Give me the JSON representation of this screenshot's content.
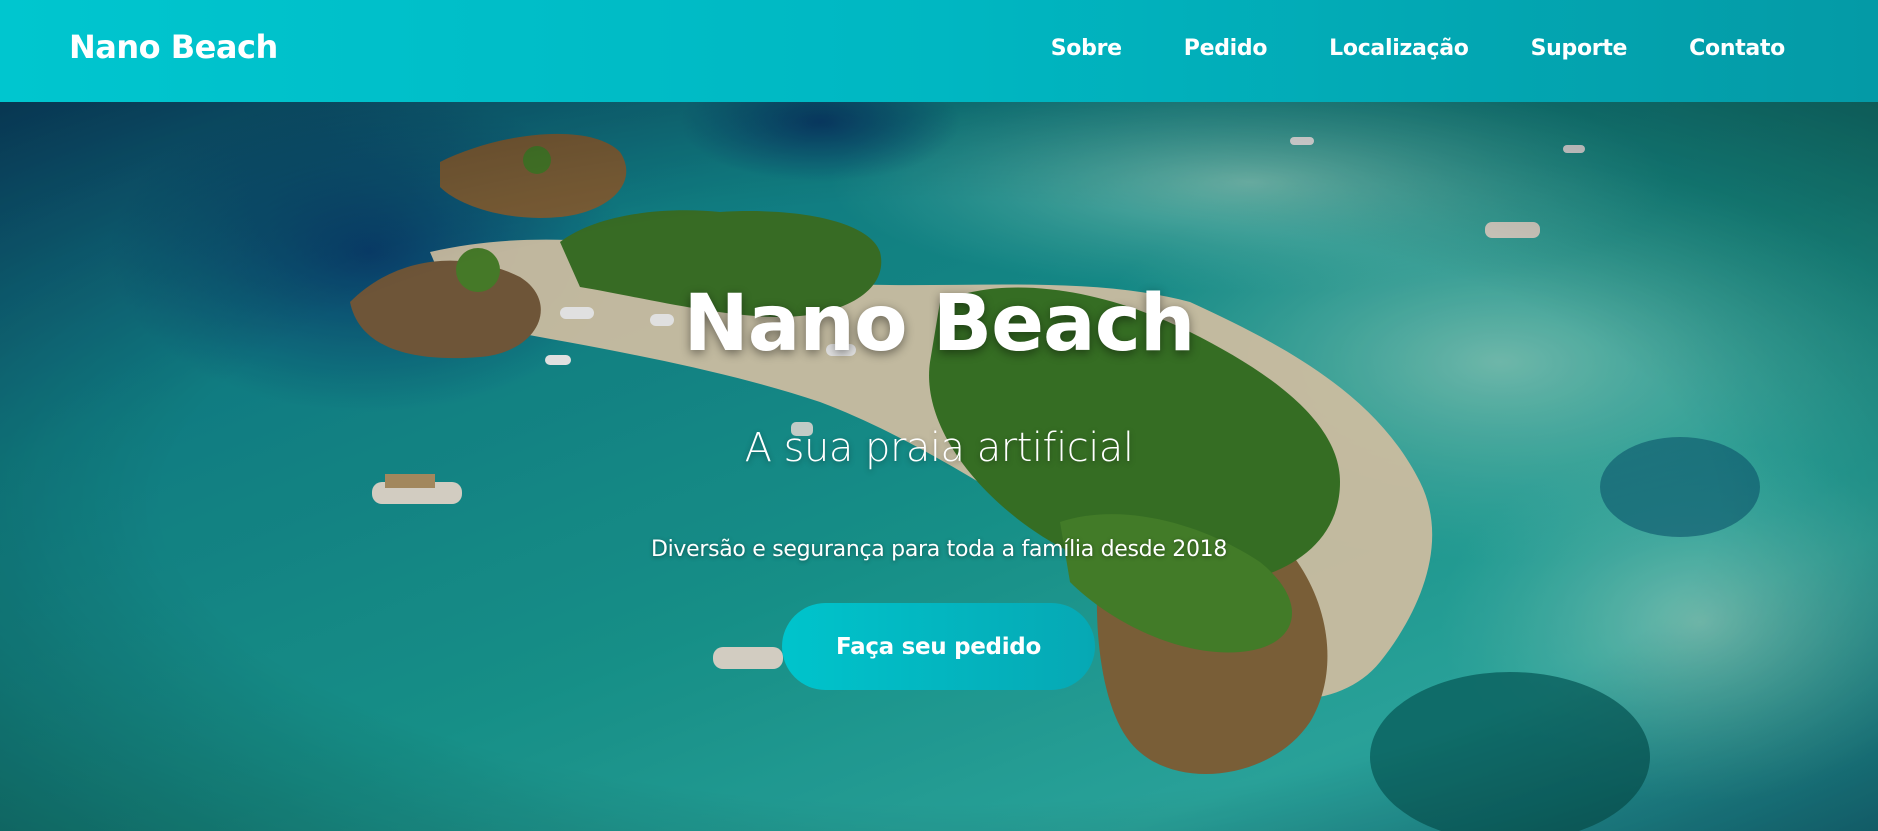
{
  "header": {
    "brand": "Nano Beach",
    "nav": [
      "Sobre",
      "Pedido",
      "Localização",
      "Suporte",
      "Contato"
    ]
  },
  "hero": {
    "title": "Nano Beach",
    "subtitle": "A sua praia artificial",
    "tagline": "Diversão e segurança para toda a família desde 2018",
    "cta_label": "Faça seu pedido",
    "background": "aerial-island-beach-photo"
  },
  "colors": {
    "header_start": "#00c6cf",
    "header_end": "#049aa6",
    "cta_start": "#00c4cc",
    "cta_end": "#06a8b4",
    "text": "#ffffff"
  }
}
